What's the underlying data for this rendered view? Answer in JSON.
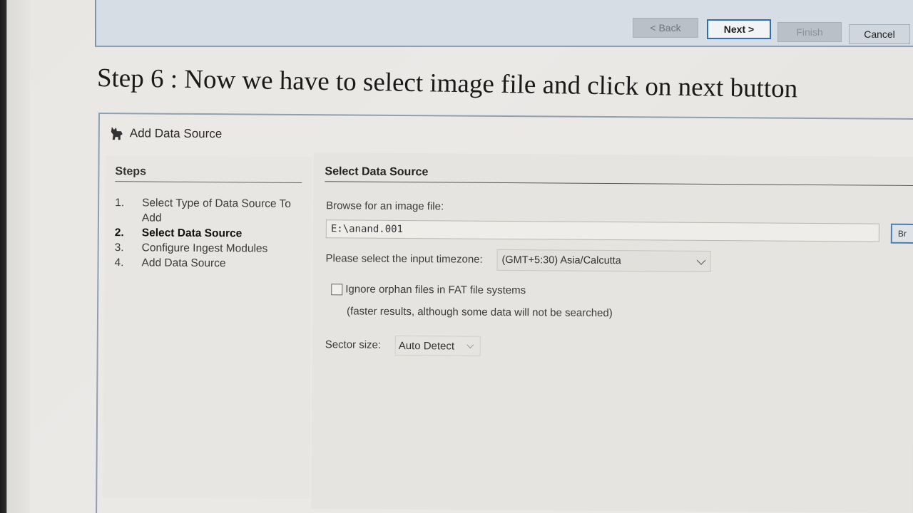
{
  "wizard_buttons": {
    "back": "< Back",
    "next": "Next >",
    "finish": "Finish",
    "cancel": "Cancel"
  },
  "step_heading": "Step 6 : Now we have to select image file and click on next button",
  "dialog": {
    "title": "Add Data Source",
    "icon": "autopsy-dog-icon"
  },
  "steps": {
    "header": "Steps",
    "items": [
      {
        "num": "1.",
        "label": "Select Type of Data Source To Add"
      },
      {
        "num": "2.",
        "label": "Select Data Source"
      },
      {
        "num": "3.",
        "label": "Configure Ingest Modules"
      },
      {
        "num": "4.",
        "label": "Add Data Source"
      }
    ],
    "current_index": 1
  },
  "main": {
    "header": "Select Data Source",
    "browse_label": "Browse for an image file:",
    "path_value": "E:\\anand.001",
    "browse_button": "Br",
    "timezone_label": "Please select the input timezone:",
    "timezone_value": "(GMT+5:30) Asia/Calcutta",
    "ignore_orphan_label": "Ignore orphan files in FAT file systems",
    "ignore_orphan_checked": false,
    "ignore_orphan_note": "(faster results, although some data will not be searched)",
    "sector_label": "Sector size:",
    "sector_value": "Auto Detect"
  },
  "colors": {
    "accent": "#2d6fb6",
    "panel": "#e6e4e0"
  }
}
